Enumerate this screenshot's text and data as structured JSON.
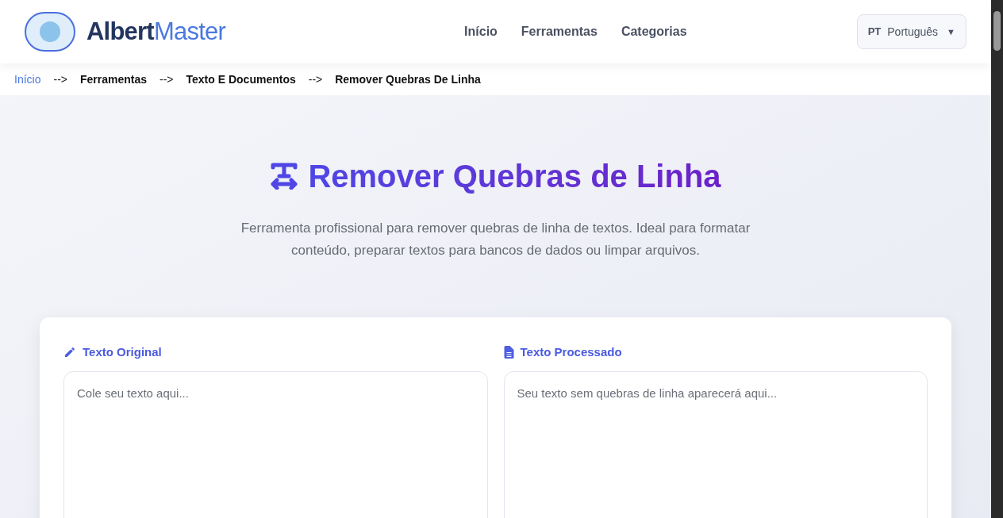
{
  "header": {
    "brand": {
      "part_1": "Albert",
      "part_2": "Master"
    },
    "nav": [
      "Início",
      "Ferramentas",
      "Categorias"
    ],
    "language": {
      "code": "PT",
      "label": "Português",
      "caret": "▼"
    }
  },
  "breadcrumb": {
    "separator": "-->",
    "items": [
      {
        "label": "Início",
        "link": true
      },
      {
        "label": "Ferramentas",
        "link": false
      },
      {
        "label": "Texto E Documentos",
        "link": false
      },
      {
        "label": "Remover Quebras De Linha",
        "link": false
      }
    ]
  },
  "hero": {
    "title": "Remover Quebras de Linha",
    "description": "Ferramenta profissional para remover quebras de linha de textos. Ideal para formatar conteúdo, preparar textos para bancos de dados ou limpar arquivos."
  },
  "panels": [
    {
      "kind": "input",
      "label": "Texto Original",
      "placeholder": "Cole seu texto aqui..."
    },
    {
      "kind": "output",
      "label": "Texto Processado",
      "placeholder": "Seu texto sem quebras de linha aparecerá aqui..."
    }
  ]
}
